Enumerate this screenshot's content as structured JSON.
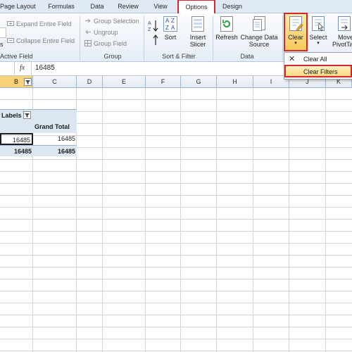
{
  "tabs": [
    "Page Layout",
    "Formulas",
    "Data",
    "Review",
    "View",
    "Options",
    "Design"
  ],
  "ribbon": {
    "active_field": {
      "expand": "Expand Entire Field",
      "collapse": "Collapse Entire Field",
      "partial": "s",
      "label": "Active Field"
    },
    "group": {
      "selection": "Group Selection",
      "ungroup": "Ungroup",
      "field": "Group Field",
      "label": "Group"
    },
    "sort_filter": {
      "sort": "Sort",
      "insert_slicer_1": "Insert",
      "insert_slicer_2": "Slicer",
      "label": "Sort & Filter"
    },
    "data": {
      "refresh": "Refresh",
      "change_1": "Change Data",
      "change_2": "Source",
      "label": "Data"
    },
    "clear": "Clear",
    "select": "Select",
    "move_1": "Move",
    "move_2": "PivotTa"
  },
  "clear_menu": {
    "clear_all": "Clear All",
    "clear_filters": "Clear Filters"
  },
  "formula_bar": {
    "fx": "fx",
    "value": "16485"
  },
  "columns": [
    "B",
    "C",
    "D",
    "E",
    "F",
    "G",
    "H",
    "I",
    "J",
    "K"
  ],
  "pivot": {
    "row_labels": "Labels",
    "grand_total": "Grand Total",
    "value_b": "16485",
    "value_c": "16485",
    "total_b": "16485",
    "total_c": "16485"
  },
  "colors": {
    "highlight": "#d6262f",
    "accent": "#f7d27a"
  }
}
